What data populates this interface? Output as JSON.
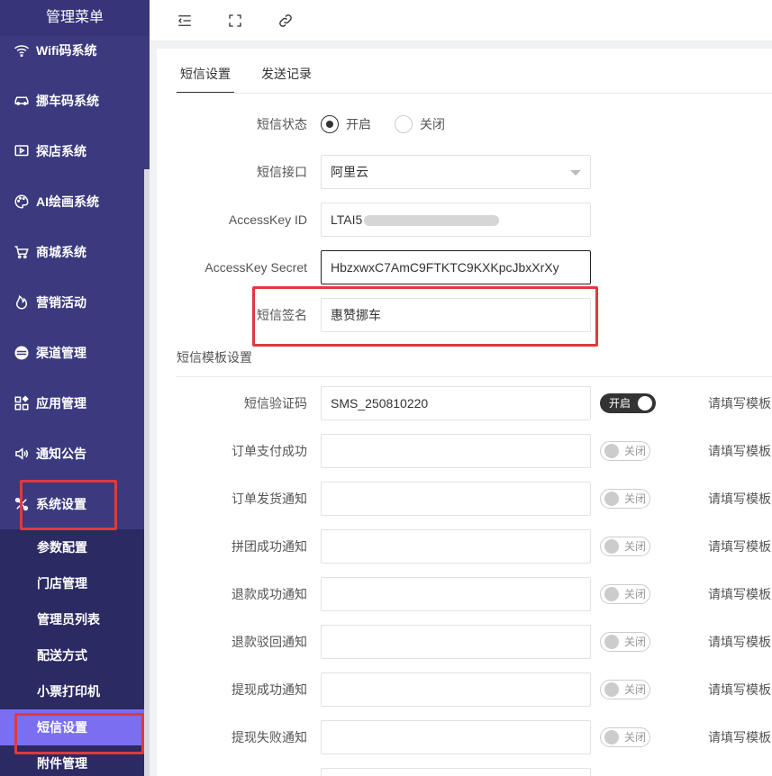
{
  "sidebar": {
    "title": "管理菜单",
    "items": [
      {
        "label": "Wifi码系统",
        "icon": "wifi-icon"
      },
      {
        "label": "挪车码系统",
        "icon": "car-icon"
      },
      {
        "label": "探店系统",
        "icon": "video-icon"
      },
      {
        "label": "AI绘画系统",
        "icon": "palette-icon"
      },
      {
        "label": "商城系统",
        "icon": "cart-icon"
      },
      {
        "label": "营销活动",
        "icon": "fire-icon"
      },
      {
        "label": "渠道管理",
        "icon": "channel-icon"
      },
      {
        "label": "应用管理",
        "icon": "apps-icon"
      },
      {
        "label": "通知公告",
        "icon": "speaker-icon"
      },
      {
        "label": "系统设置",
        "icon": "settings-icon"
      }
    ],
    "submenu": [
      "参数配置",
      "门店管理",
      "管理员列表",
      "配送方式",
      "小票打印机",
      "短信设置",
      "附件管理"
    ]
  },
  "tabs": [
    "短信设置",
    "发送记录"
  ],
  "form": {
    "status_label": "短信状态",
    "status_on": "开启",
    "status_off": "关闭",
    "api_label": "短信接口",
    "api_value": "阿里云",
    "key_id_label": "AccessKey ID",
    "key_id_value": "LTAI5",
    "secret_label": "AccessKey Secret",
    "secret_value": "HbzxwxC7AmC9FTKTC9KXKpcJbxXrXy",
    "sign_label": "短信签名",
    "sign_value": "惠赞挪车"
  },
  "template_section": {
    "title": "短信模板设置",
    "switch_on": "开启",
    "switch_off": "关闭",
    "tip": "请填写模板",
    "rows": [
      {
        "label": "短信验证码",
        "value": "SMS_250810220",
        "enabled": true
      },
      {
        "label": "订单支付成功",
        "value": "",
        "enabled": false
      },
      {
        "label": "订单发货通知",
        "value": "",
        "enabled": false
      },
      {
        "label": "拼团成功通知",
        "value": "",
        "enabled": false
      },
      {
        "label": "退款成功通知",
        "value": "",
        "enabled": false
      },
      {
        "label": "退款驳回通知",
        "value": "",
        "enabled": false
      },
      {
        "label": "提现成功通知",
        "value": "",
        "enabled": false
      },
      {
        "label": "提现失败通知",
        "value": "",
        "enabled": false
      }
    ]
  }
}
